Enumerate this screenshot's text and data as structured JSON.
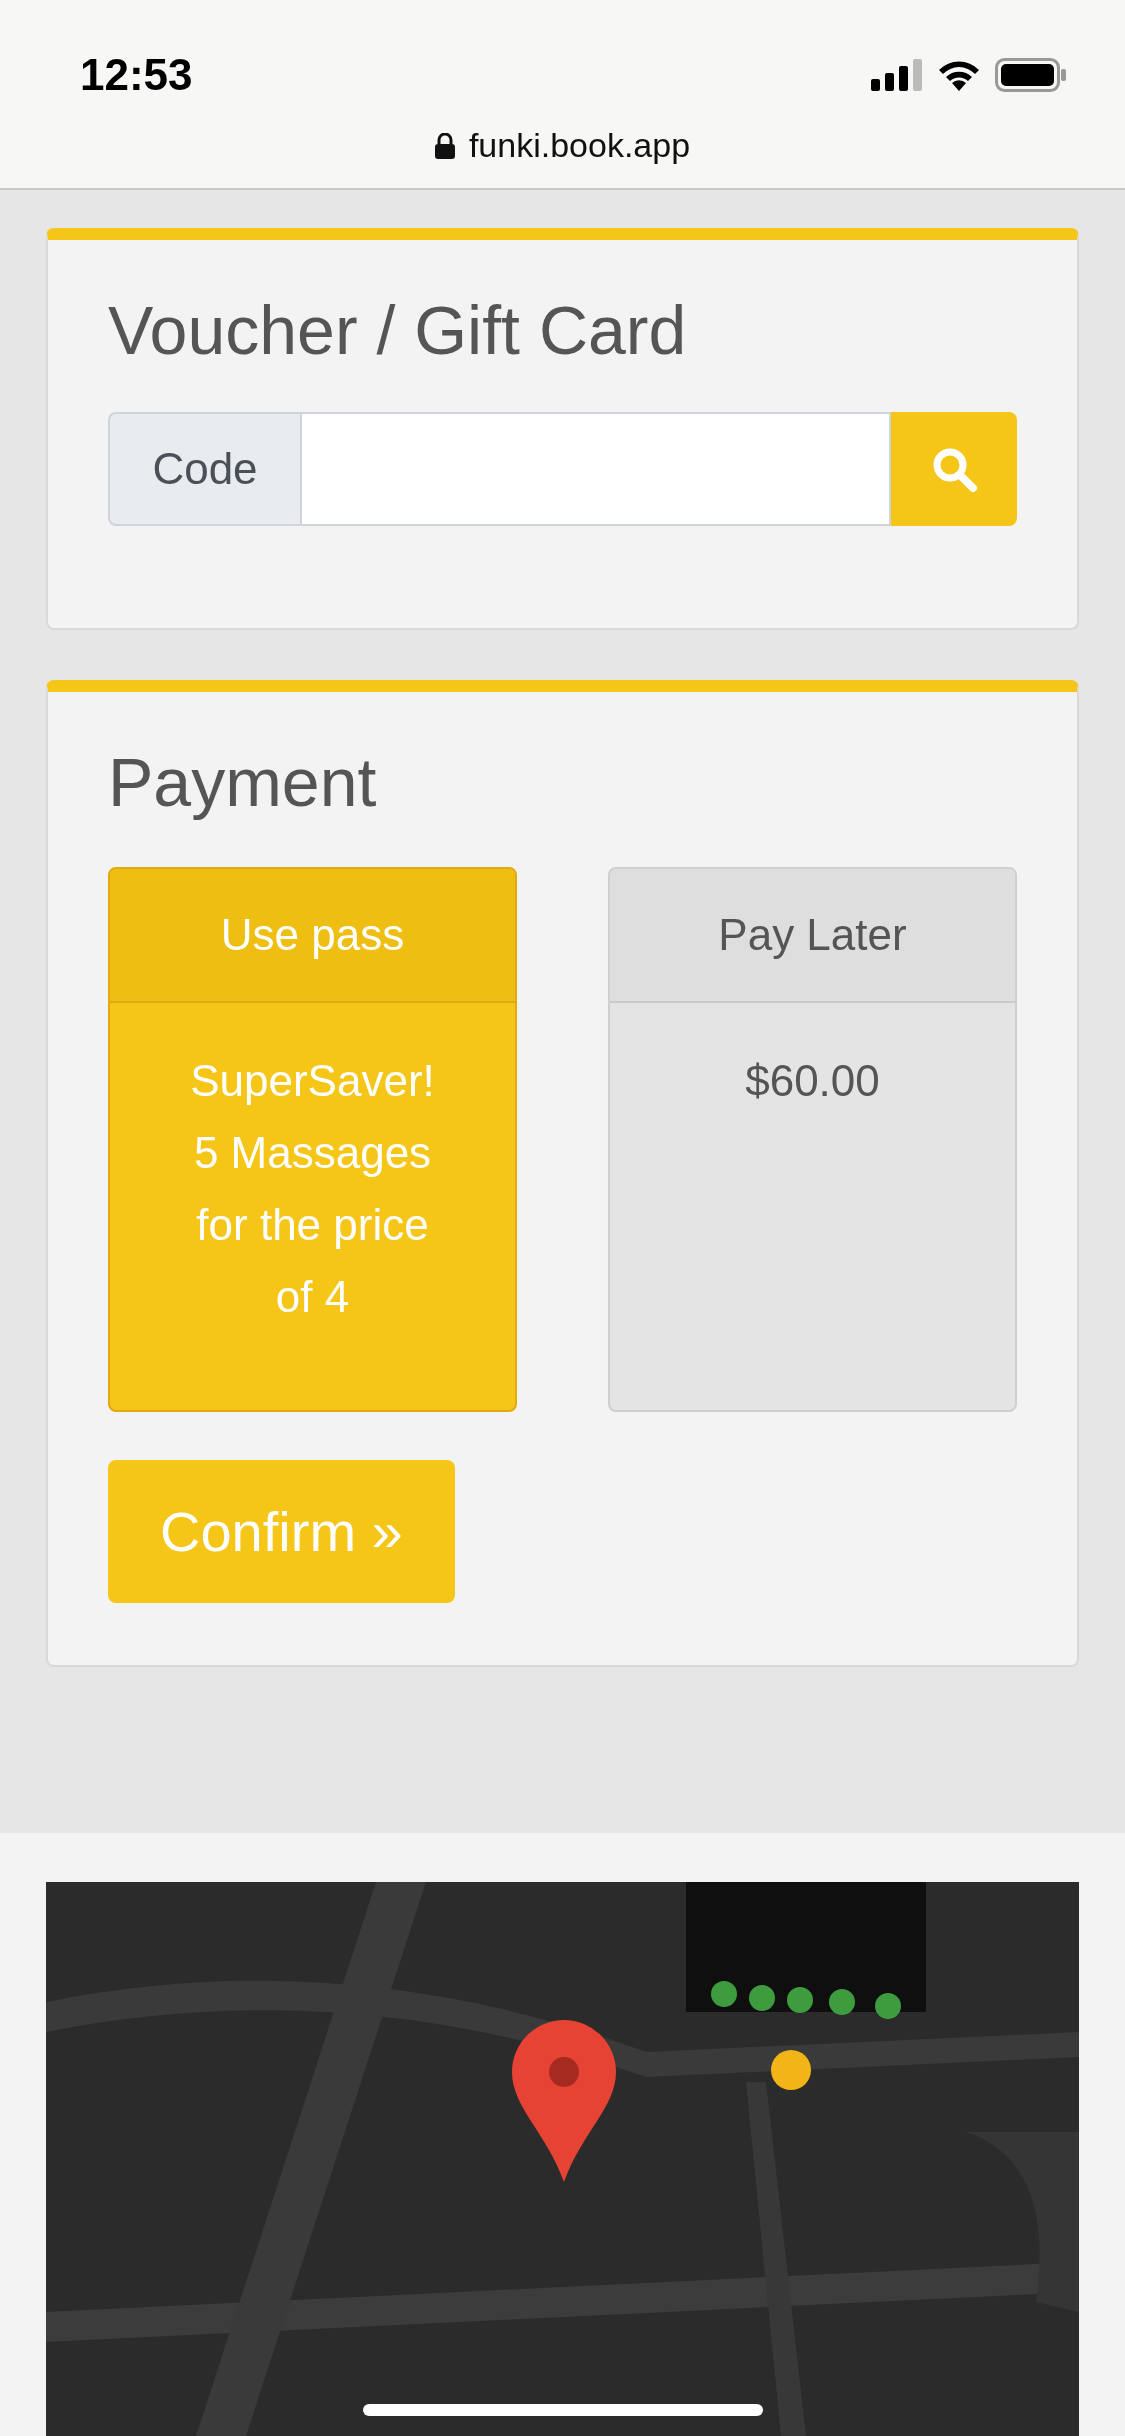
{
  "status_bar": {
    "time": "12:53"
  },
  "browser": {
    "url": "funki.book.app"
  },
  "voucher": {
    "title": "Voucher / Gift Card",
    "code_label": "Code"
  },
  "payment": {
    "title": "Payment",
    "options": [
      {
        "label": "Use pass",
        "detail": "SuperSaver! 5 Massages for the price of 4",
        "selected": true
      },
      {
        "label": "Pay Later",
        "detail": "$60.00",
        "selected": false
      }
    ],
    "confirm": "Confirm »"
  }
}
